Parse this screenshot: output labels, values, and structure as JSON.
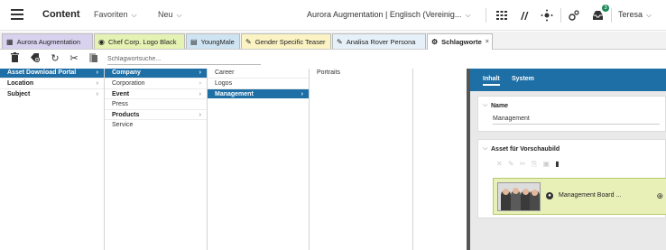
{
  "header": {
    "title": "Content",
    "menu": [
      {
        "label": "Favoriten"
      },
      {
        "label": "Neu"
      }
    ],
    "site_selector": "Aurora Augmentation | Englisch (Vereinig...",
    "notification_count": "3",
    "user": "Teresa",
    "icons": [
      "menu-icon",
      "chevron-down-icon",
      "grid-icon",
      "analytics-icon",
      "workflow-icon",
      "puzzle-icon",
      "inbox-icon"
    ]
  },
  "tabs": [
    {
      "label": "Aurora Augmentation",
      "icon": "site-icon",
      "color": "#d9d2ef"
    },
    {
      "label": "Chef Corp. Logo Black",
      "icon": "picture-icon",
      "color": "#e4f2b3"
    },
    {
      "label": "YoungMale",
      "icon": "persona-icon",
      "color": "#cfe4f3"
    },
    {
      "label": "Gender Specific Teaser",
      "icon": "pencil-icon",
      "color": "#fbf3c3"
    },
    {
      "label": "Analisa Rover Persona",
      "icon": "pencil-icon",
      "color": "#e6f0f8"
    },
    {
      "label": "Schlagworte",
      "icon": "tag-icon",
      "close": "×",
      "color": "#ffffff"
    }
  ],
  "toolbar": {
    "search_placeholder": "Schlagwortsuche...",
    "icons": [
      "delete-icon",
      "add-tag-icon",
      "refresh-icon",
      "cut-icon",
      "paste-icon"
    ]
  },
  "columns": [
    {
      "rows": [
        {
          "label": "Asset Download Portal",
          "state": "header",
          "arrow": "›"
        },
        {
          "label": "Location",
          "state": "bold",
          "arrow": "›"
        },
        {
          "label": "Subject",
          "state": "bold",
          "arrow": "›"
        }
      ]
    },
    {
      "rows": [
        {
          "label": "Company",
          "state": "selected",
          "arrow": "›"
        },
        {
          "label": "Corporation",
          "state": "normal",
          "arrow": "›"
        },
        {
          "label": "Event",
          "state": "bold",
          "arrow": "›"
        },
        {
          "label": "Press",
          "state": "normal",
          "arrow": ""
        },
        {
          "label": "Products",
          "state": "bold",
          "arrow": "›"
        },
        {
          "label": "Service",
          "state": "normal",
          "arrow": ""
        }
      ]
    },
    {
      "rows": [
        {
          "label": "Career",
          "state": "normal",
          "arrow": ""
        },
        {
          "label": "Logos",
          "state": "normal",
          "arrow": ""
        },
        {
          "label": "Management",
          "state": "selected",
          "arrow": "›"
        }
      ]
    },
    {
      "rows": [
        {
          "label": "Portraits",
          "state": "normal",
          "arrow": ""
        }
      ]
    }
  ],
  "panel": {
    "tabs": [
      {
        "label": "Inhalt",
        "active": true
      },
      {
        "label": "System",
        "active": false
      }
    ],
    "name_card": {
      "title": "Name",
      "value": "Management"
    },
    "preview_card": {
      "title": "Asset für Vorschaubild",
      "linked_item": "Management Board ..."
    }
  }
}
